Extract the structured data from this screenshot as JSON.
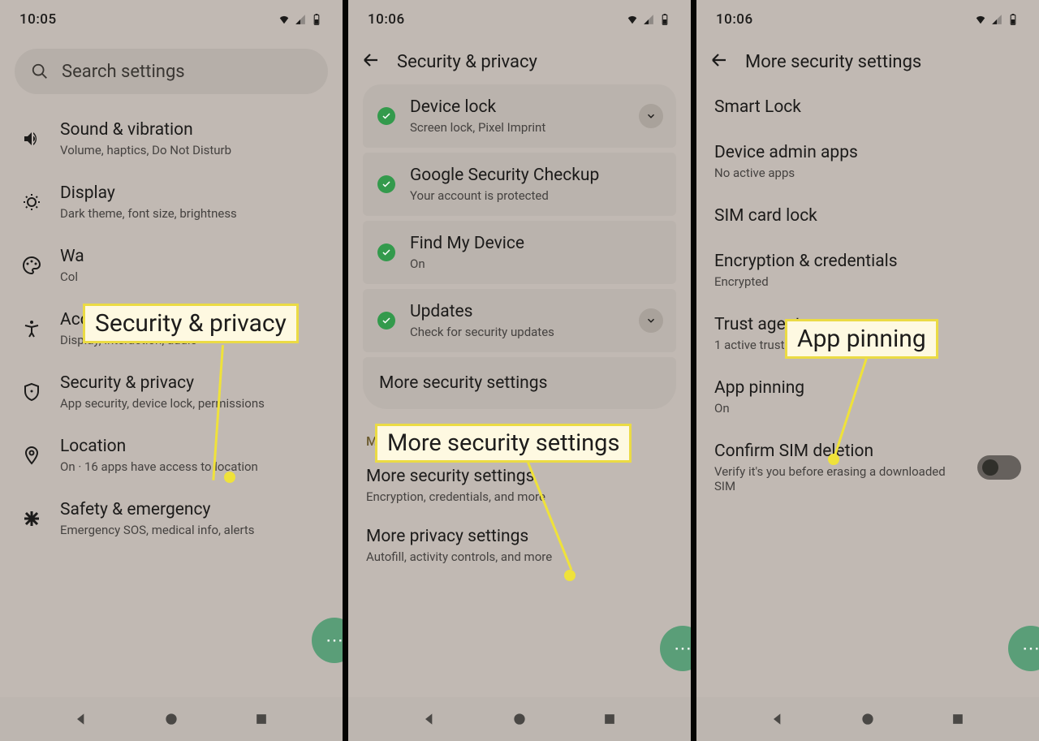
{
  "panel1": {
    "time": "10:05",
    "search_placeholder": "Search settings",
    "items": [
      {
        "icon": "volume",
        "title": "Sound & vibration",
        "sub": "Volume, haptics, Do Not Disturb"
      },
      {
        "icon": "brightness",
        "title": "Display",
        "sub": "Dark theme, font size, brightness"
      },
      {
        "icon": "palette",
        "title": "Wa",
        "sub": "Col"
      },
      {
        "icon": "accessibility",
        "title": "Accessibility",
        "sub": "Display, interaction, audio"
      },
      {
        "icon": "shield",
        "title": "Security & privacy",
        "sub": "App security, device lock, permissions"
      },
      {
        "icon": "pin",
        "title": "Location",
        "sub": "On · 16 apps have access to location"
      },
      {
        "icon": "asterisk",
        "title": "Safety & emergency",
        "sub": "Emergency SOS, medical info, alerts"
      }
    ],
    "callout": "Security & privacy"
  },
  "panel2": {
    "time": "10:06",
    "page_title": "Security & privacy",
    "cards": [
      {
        "title": "Device lock",
        "sub": "Screen lock, Pixel Imprint",
        "chev": true
      },
      {
        "title": "Google Security Checkup",
        "sub": "Your account is protected",
        "chev": false
      },
      {
        "title": "Find My Device",
        "sub": "On",
        "chev": false
      },
      {
        "title": "Updates",
        "sub": "Check for security updates",
        "chev": true
      }
    ],
    "more_card": "More security settings",
    "section_label": "More settings",
    "plain_items": [
      {
        "title": "More security settings",
        "sub": "Encryption, credentials, and more"
      },
      {
        "title": "More privacy settings",
        "sub": "Autofill, activity controls, and more"
      }
    ],
    "callout": "More security settings"
  },
  "panel3": {
    "time": "10:06",
    "page_title": "More security settings",
    "rows": [
      {
        "title": "Smart Lock",
        "sub": ""
      },
      {
        "title": "Device admin apps",
        "sub": "No active apps"
      },
      {
        "title": "SIM card lock",
        "sub": ""
      },
      {
        "title": "Encryption & credentials",
        "sub": "Encrypted"
      },
      {
        "title": "Trust agents",
        "sub": "1 active trust agent"
      },
      {
        "title": "App pinning",
        "sub": "On"
      },
      {
        "title": "Confirm SIM deletion",
        "sub": "Verify it's you before erasing a downloaded SIM",
        "switch": true
      }
    ],
    "callout": "App pinning"
  }
}
